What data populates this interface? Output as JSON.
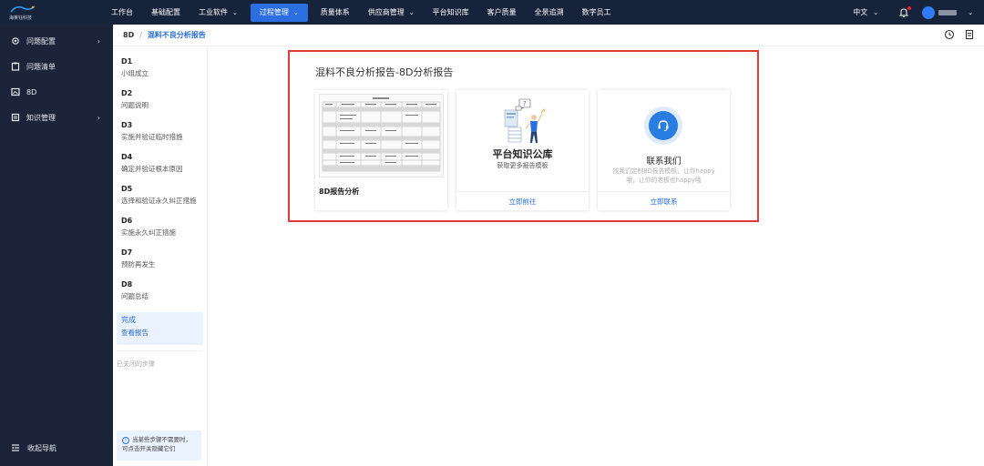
{
  "topbar": {
    "logo_text": "海莱钰科技",
    "nav": [
      {
        "label": "工作台",
        "has_dropdown": false
      },
      {
        "label": "基础配置",
        "has_dropdown": false
      },
      {
        "label": "工业软件",
        "has_dropdown": true
      },
      {
        "label": "过程管理",
        "has_dropdown": true,
        "active": true
      },
      {
        "label": "质量体系",
        "has_dropdown": false
      },
      {
        "label": "供应商管理",
        "has_dropdown": true
      },
      {
        "label": "平台知识库",
        "has_dropdown": false
      },
      {
        "label": "客户质量",
        "has_dropdown": false
      },
      {
        "label": "全景追溯",
        "has_dropdown": false
      },
      {
        "label": "数字员工",
        "has_dropdown": false
      }
    ],
    "language": "中文",
    "chevron": "⌄",
    "accent_color": "#2a6ee0",
    "bg_color": "#17223b"
  },
  "sidebar": {
    "items": [
      {
        "label": "问题配置",
        "icon": "gear-icon",
        "has_arrow": true
      },
      {
        "label": "问题清单",
        "icon": "clipboard-icon",
        "has_arrow": false
      },
      {
        "label": "8D",
        "icon": "image-icon",
        "has_arrow": false
      },
      {
        "label": "知识管理",
        "icon": "book-icon",
        "has_arrow": true
      }
    ],
    "arrow": "›",
    "collapse_label": "收起导航"
  },
  "breadcrumb": {
    "root": "8D",
    "separator": "/",
    "current": "混料不良分析报告"
  },
  "steps": [
    {
      "code": "D1",
      "desc": "小组成立"
    },
    {
      "code": "D2",
      "desc": "问题说明"
    },
    {
      "code": "D3",
      "desc": "实施并验证临时措施"
    },
    {
      "code": "D4",
      "desc": "确定并验证根本原因"
    },
    {
      "code": "D5",
      "desc": "选择和验证永久纠正措施"
    },
    {
      "code": "D6",
      "desc": "实施永久纠正措施"
    },
    {
      "code": "D7",
      "desc": "预防再发生"
    },
    {
      "code": "D8",
      "desc": "问题总结"
    }
  ],
  "done_step": {
    "code": "完成",
    "desc": "查看报告"
  },
  "closed_steps_label": "已关闭的步骤",
  "tip": {
    "icon": "i",
    "line1": "当某些步骤不需要时，",
    "line2": "可点击开关隐藏它们"
  },
  "main": {
    "title": "混料不良分析报告-8D分析报告",
    "cards": {
      "report": {
        "label": "8D报告分析"
      },
      "library": {
        "title": "平台知识公库",
        "subtitle": "获取更多报告模板",
        "action": "立即前往"
      },
      "contact": {
        "title": "联系我们",
        "subtitle_line1": "找我们定制8D报告模板，让你happy",
        "subtitle_line2": "哦，让你的老板也happy哦",
        "action": "立即联系"
      }
    },
    "highlight_color": "#e03a3a"
  }
}
